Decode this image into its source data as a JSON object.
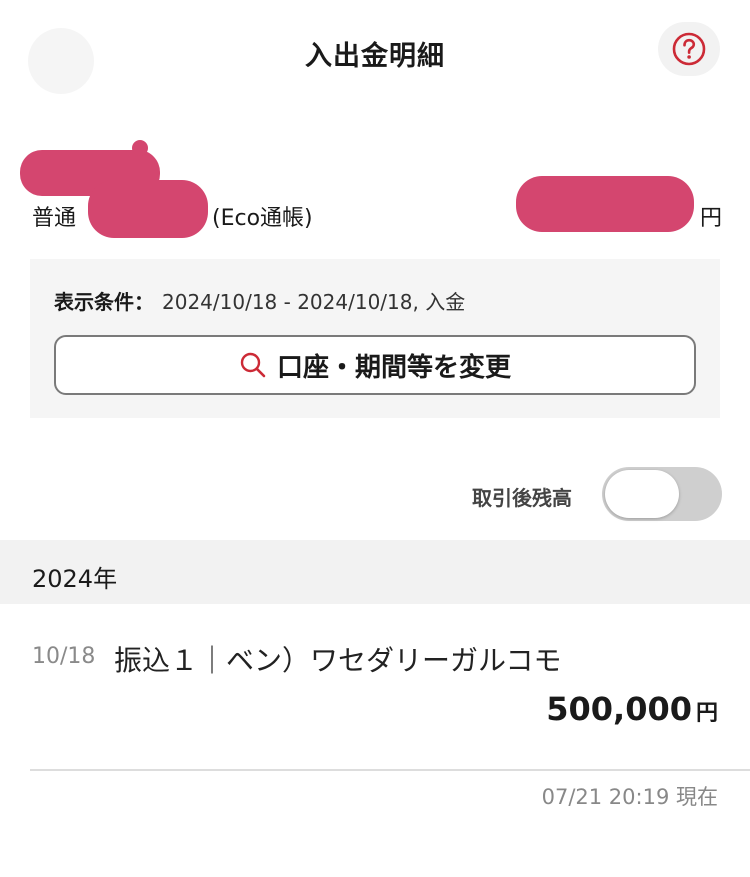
{
  "header": {
    "title": "入出金明細",
    "help_icon": "question-circle-icon",
    "accent_color": "#cc2a36"
  },
  "account": {
    "type": "普通",
    "name": "(Eco通帳)",
    "balance_unit": "円"
  },
  "condition": {
    "label": "表示条件：",
    "value": "2024/10/18 - 2024/10/18, 入金",
    "change_button_label": "口座・期間等を変更",
    "search_icon": "search-icon"
  },
  "toggle": {
    "label": "取引後残高",
    "on": false
  },
  "year_header": "2024年",
  "transactions": [
    {
      "date": "10/18",
      "description": "振込１｜ベン）ワセダリーガルコモ",
      "amount": "500,000",
      "unit": "円"
    }
  ],
  "timestamp": "07/21 20:19 現在"
}
